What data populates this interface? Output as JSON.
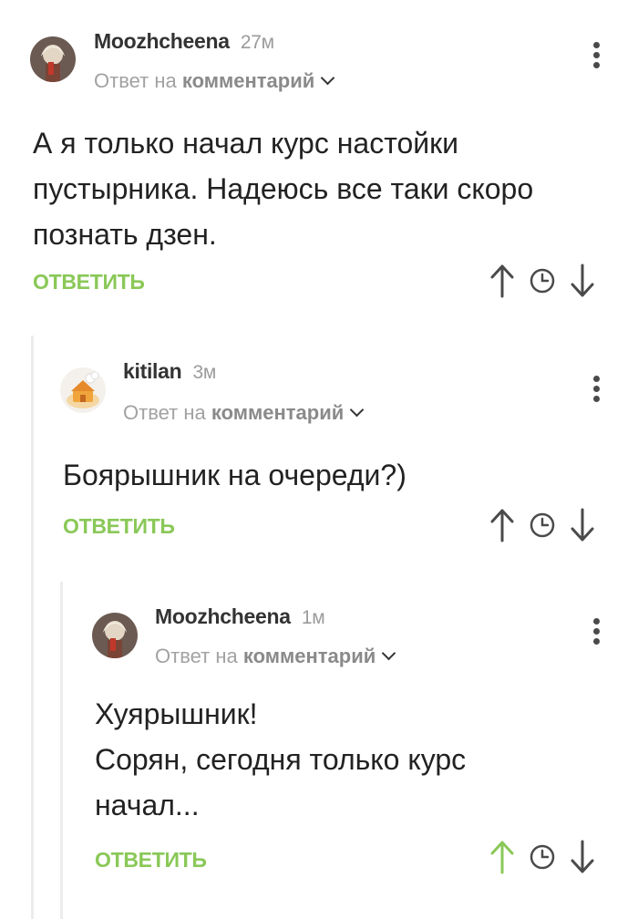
{
  "comments": [
    {
      "author": "Moozhcheena",
      "time": "27м",
      "reply_prefix": "Ответ на",
      "reply_target": "комментарий",
      "lines": [
        "А я только начал курс настойки",
        "пустырника. Надеюсь все таки скоро",
        "познать дзен."
      ],
      "reply_label": "ОТВЕТИТЬ",
      "upvoted": false
    },
    {
      "author": "kitilan",
      "time": "3м",
      "reply_prefix": "Ответ на",
      "reply_target": "комментарий",
      "lines": [
        "Боярышник на очереди?)"
      ],
      "reply_label": "ОТВЕТИТЬ",
      "upvoted": false
    },
    {
      "author": "Moozhcheena",
      "time": "1м",
      "reply_prefix": "Ответ на",
      "reply_target": "комментарий",
      "lines": [
        "Хуярышник!",
        "Сорян, сегодня только курс",
        "начал..."
      ],
      "reply_label": "ОТВЕТИТЬ",
      "upvoted": true
    }
  ],
  "icons": {
    "upvote": "arrow-up-icon",
    "save": "clock-icon",
    "downvote": "arrow-down-icon",
    "menu": "more-vertical-icon"
  },
  "colors": {
    "accent_green": "#8ac858",
    "icon_gray": "#4a4a4a",
    "thread_line": "#ececec"
  }
}
